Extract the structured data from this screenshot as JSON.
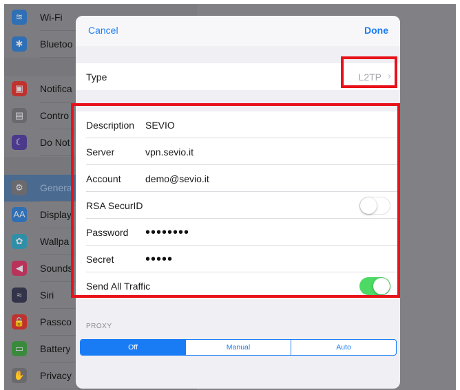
{
  "sidebar": {
    "items": [
      {
        "label": "Wi-Fi",
        "icon": "wifi-icon",
        "color": "#2f6fb5",
        "glyph": "≋"
      },
      {
        "label": "Bluetoo",
        "icon": "bluetooth-icon",
        "color": "#2f6fb5",
        "glyph": "✱"
      },
      {
        "label": "Notifica",
        "icon": "notifications-icon",
        "color": "#c0322e",
        "glyph": "▣"
      },
      {
        "label": "Contro",
        "icon": "control-center-icon",
        "color": "#6a6a6e",
        "glyph": "▤"
      },
      {
        "label": "Do Not",
        "icon": "do-not-disturb-icon",
        "color": "#4b3a8c",
        "glyph": "☾"
      },
      {
        "label": "Genera",
        "icon": "gear-icon",
        "color": "#6a6a6e",
        "glyph": "⚙"
      },
      {
        "label": "Display",
        "icon": "display-icon",
        "color": "#2f6fb5",
        "glyph": "AA"
      },
      {
        "label": "Wallpa",
        "icon": "wallpaper-icon",
        "color": "#2f8fa8",
        "glyph": "✿"
      },
      {
        "label": "Sounds",
        "icon": "sounds-icon",
        "color": "#b8325a",
        "glyph": "◀"
      },
      {
        "label": "Siri",
        "icon": "siri-icon",
        "color": "#33334a",
        "glyph": "≈"
      },
      {
        "label": "Passco",
        "icon": "passcode-icon",
        "color": "#c0322e",
        "glyph": "🔒"
      },
      {
        "label": "Battery",
        "icon": "battery-icon",
        "color": "#3a8a3e",
        "glyph": "▭"
      },
      {
        "label": "Privacy",
        "icon": "privacy-icon",
        "color": "#6a6a6e",
        "glyph": "✋"
      }
    ]
  },
  "modal": {
    "cancel_label": "Cancel",
    "done_label": "Done",
    "type_label": "Type",
    "type_value": "L2TP",
    "fields": {
      "description_label": "Description",
      "description_value": "SEVIO",
      "server_label": "Server",
      "server_value": "vpn.sevio.it",
      "account_label": "Account",
      "account_value": "demo@sevio.it",
      "rsa_label": "RSA SecurID",
      "rsa_on": false,
      "password_label": "Password",
      "password_value": "••••••••",
      "secret_label": "Secret",
      "secret_value": "•••••",
      "send_all_label": "Send All Traffic",
      "send_all_on": true
    },
    "proxy_header": "PROXY",
    "proxy_options": [
      "Off",
      "Manual",
      "Auto"
    ],
    "proxy_selected": "Off"
  },
  "colors": {
    "accent": "#1a7cf5",
    "toggle_on": "#4cd964",
    "highlight": "#e8121a"
  }
}
